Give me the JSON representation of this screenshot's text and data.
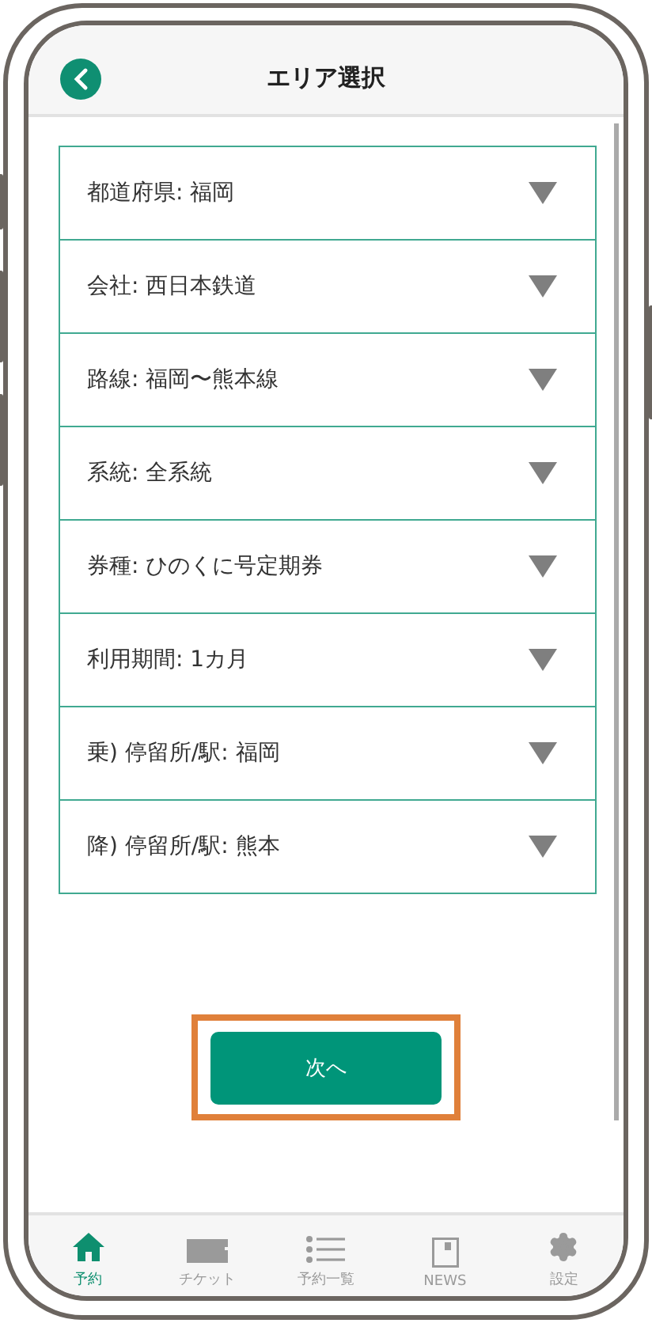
{
  "header": {
    "title": "エリア選択"
  },
  "selectors": [
    {
      "label": "都道府県: 福岡"
    },
    {
      "label": "会社: 西日本鉄道"
    },
    {
      "label": "路線: 福岡〜熊本線"
    },
    {
      "label": "系統: 全系統"
    },
    {
      "label": "券種: ひのくに号定期券"
    },
    {
      "label": "利用期間: 1カ月"
    },
    {
      "label": "乗) 停留所/駅: 福岡"
    },
    {
      "label": "降) 停留所/駅: 熊本"
    }
  ],
  "next_button": {
    "label": "次へ",
    "highlighted": true
  },
  "tab_bar": [
    {
      "label": "予約",
      "kind": "home",
      "selected": true
    },
    {
      "label": "チケット",
      "kind": "ticket",
      "selected": false
    },
    {
      "label": "予約一覧",
      "kind": "list",
      "selected": false
    },
    {
      "label": "NEWS",
      "kind": "news",
      "selected": false
    },
    {
      "label": "設定",
      "kind": "gear",
      "selected": false
    }
  ]
}
